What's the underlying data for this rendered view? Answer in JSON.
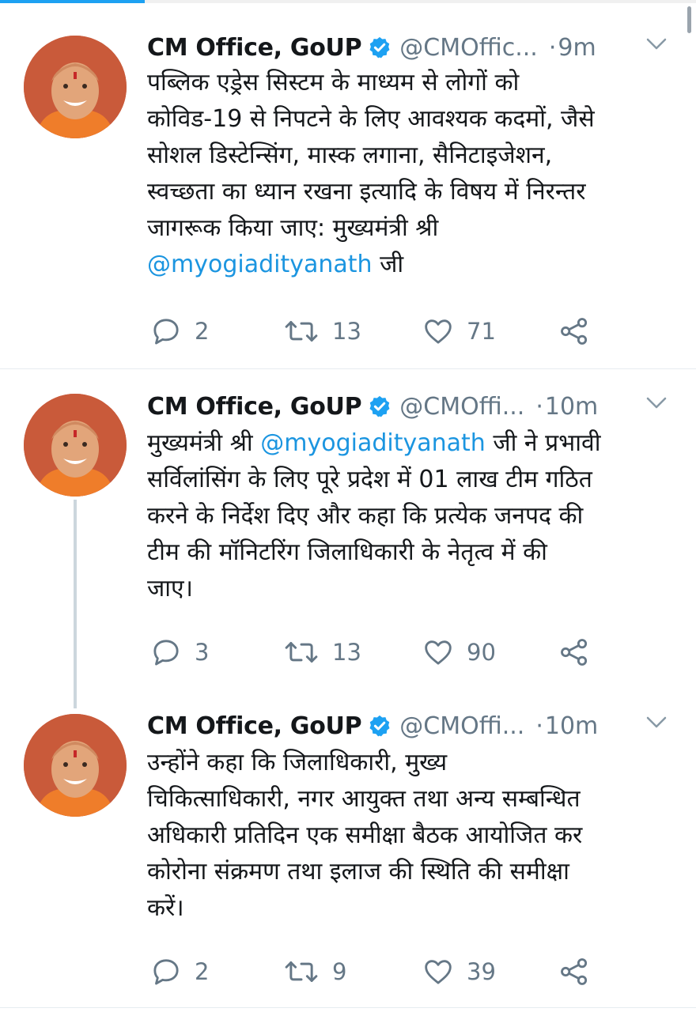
{
  "tweets": [
    {
      "name": "CM Office, GoUP",
      "handle": "@CMOffic...",
      "time": "9m",
      "text_lines": [
        "पब्लिक एड्रेस सिस्टम के माध्यम से लोगों को",
        "कोविड-19 से निपटने के लिए आवश्यक कदमों, जैसे",
        "सोशल डिस्टेन्सिंग, मास्क लगाना, सैनिटाइजेशन,",
        "स्वच्छता का ध्यान रखना इत्यादि के विषय में निरन्तर",
        "जागरूक किया जाए: मुख्यमंत्री श्री"
      ],
      "text_last_mention": "@myogiadityanath",
      "text_last_suffix": " जी",
      "replies": "2",
      "retweets": "13",
      "likes": "71"
    },
    {
      "name": "CM Office, GoUP",
      "handle": "@CMOffi...",
      "time": "10m",
      "text_first_prefix": "मुख्यमंत्री श्री ",
      "text_first_mention": "@myogiadityanath",
      "text_first_suffix": " जी ने प्रभावी",
      "text_lines": [
        "सर्विलांसिंग के लिए पूरे प्रदेश में 01 लाख टीम गठित",
        "करने के निर्देश दिए और कहा कि प्रत्येक जनपद की",
        "टीम की मॉनिटरिंग जिलाधिकारी के नेतृत्व में की",
        "जाए।"
      ],
      "replies": "3",
      "retweets": "13",
      "likes": "90"
    },
    {
      "name": "CM Office, GoUP",
      "handle": "@CMOffi...",
      "time": "10m",
      "text_lines": [
        "उन्होंने कहा कि जिलाधिकारी, मुख्य",
        "चिकित्साधिकारी, नगर आयुक्त तथा अन्य सम्बन्धित",
        "अधिकारी प्रतिदिन एक समीक्षा बैठक आयोजित कर",
        "कोरोना संक्रमण तथा इलाज की स्थिति की समीक्षा",
        "करें।"
      ],
      "replies": "2",
      "retweets": "9",
      "likes": "39"
    }
  ],
  "icons": {
    "reply": "reply-icon",
    "retweet": "retweet-icon",
    "like": "heart-icon",
    "share": "share-icon",
    "verified": "verified-badge-icon",
    "caret": "chevron-down-icon"
  },
  "colors": {
    "accent": "#1da1f2",
    "mention": "#1b95e0",
    "secondary_text": "#657786",
    "avatar_bg": "#c95a3a"
  }
}
